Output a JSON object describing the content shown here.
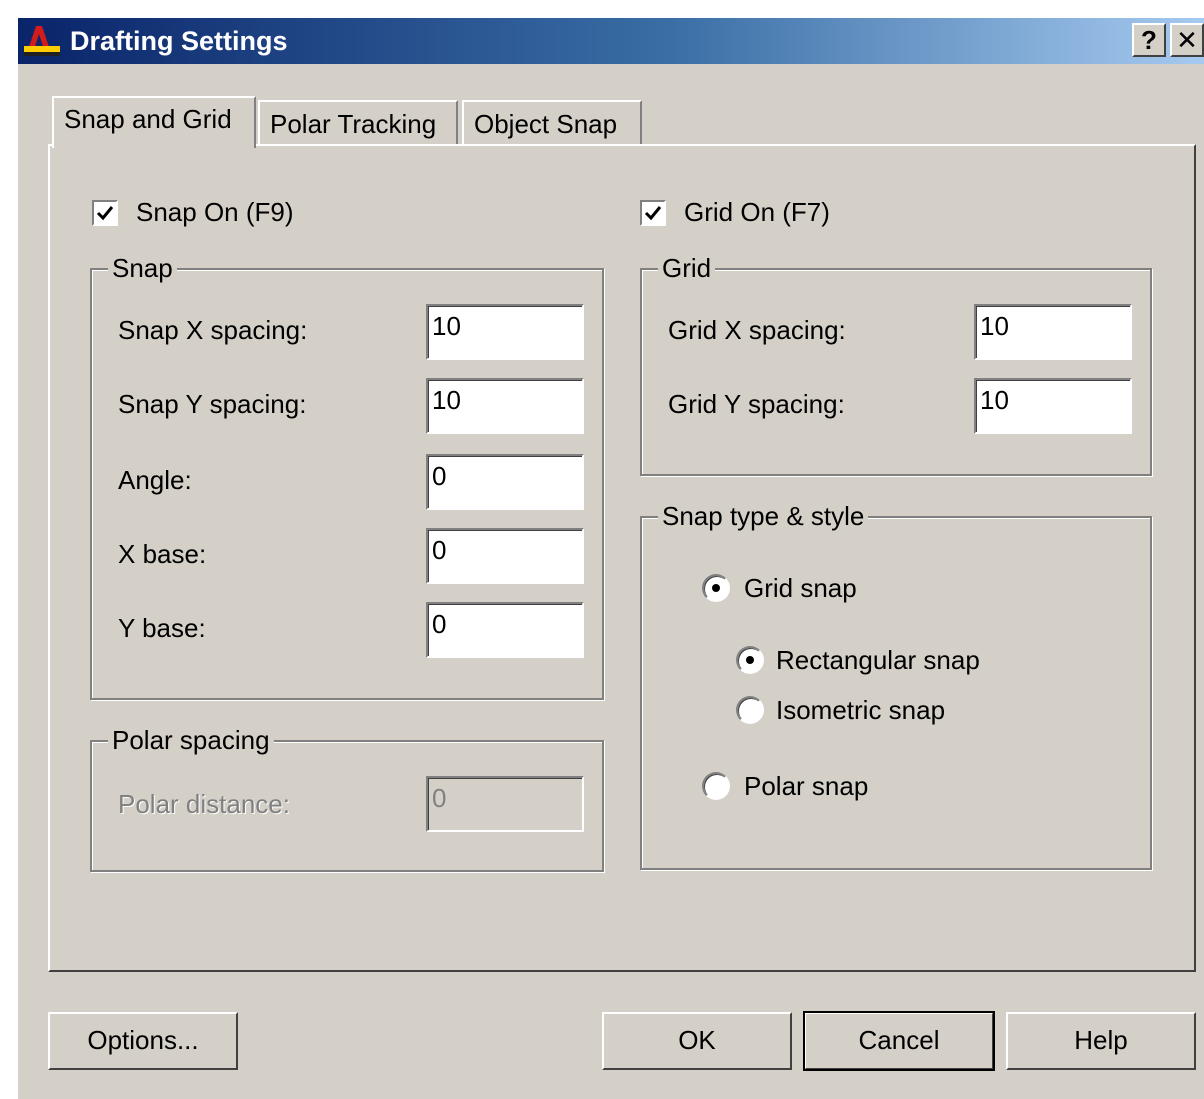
{
  "window": {
    "title": "Drafting Settings",
    "help_button": "?",
    "close_button": "✕",
    "app_icon": "autocad-icon"
  },
  "tabs": [
    {
      "label": "Snap and Grid",
      "active": true
    },
    {
      "label": "Polar Tracking",
      "active": false
    },
    {
      "label": "Object Snap",
      "active": false
    }
  ],
  "snap_on": {
    "label": "Snap On (F9)",
    "checked": true
  },
  "grid_on": {
    "label": "Grid On (F7)",
    "checked": true
  },
  "snap_group": {
    "title": "Snap",
    "fields": [
      {
        "label": "Snap X spacing:",
        "value": "10"
      },
      {
        "label": "Snap Y spacing:",
        "value": "10"
      },
      {
        "label": "Angle:",
        "value": "0"
      },
      {
        "label": "X base:",
        "value": "0"
      },
      {
        "label": "Y base:",
        "value": "0"
      }
    ]
  },
  "polar_group": {
    "title": "Polar spacing",
    "field": {
      "label": "Polar distance:",
      "value": "0",
      "disabled": true
    }
  },
  "grid_group": {
    "title": "Grid",
    "fields": [
      {
        "label": "Grid X spacing:",
        "value": "10"
      },
      {
        "label": "Grid Y spacing:",
        "value": "10"
      }
    ]
  },
  "snap_type_group": {
    "title": "Snap type & style",
    "options": {
      "grid_snap": {
        "label": "Grid snap",
        "selected": true
      },
      "rectangular_snap": {
        "label": "Rectangular snap",
        "selected": true
      },
      "isometric_snap": {
        "label": "Isometric snap",
        "selected": false
      },
      "polar_snap": {
        "label": "Polar snap",
        "selected": false
      }
    }
  },
  "buttons": {
    "options": "Options...",
    "ok": "OK",
    "cancel": "Cancel",
    "help": "Help"
  },
  "colors": {
    "dialog_face": "#d4d0c8",
    "title_gradient_start": "#0a246a",
    "title_gradient_end": "#a6caf0"
  }
}
